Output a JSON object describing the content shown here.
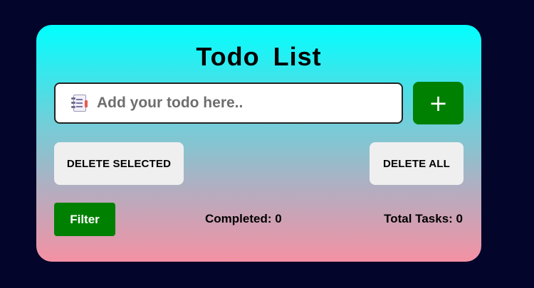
{
  "app": {
    "title": "Todo List"
  },
  "input": {
    "icon": "notepad-icon",
    "placeholder": "Add your todo here..",
    "value": ""
  },
  "buttons": {
    "add_label": "+",
    "delete_selected_label": "DELETE SELECTED",
    "delete_all_label": "DELETE ALL",
    "filter_label": "Filter"
  },
  "stats": {
    "completed_label": "Completed: 0",
    "total_label": "Total Tasks: 0"
  },
  "colors": {
    "background": "#03052a",
    "gradient_top": "#00ffff",
    "gradient_bottom": "#f491a3",
    "accent_green": "#008000",
    "button_grey": "#efefef"
  }
}
